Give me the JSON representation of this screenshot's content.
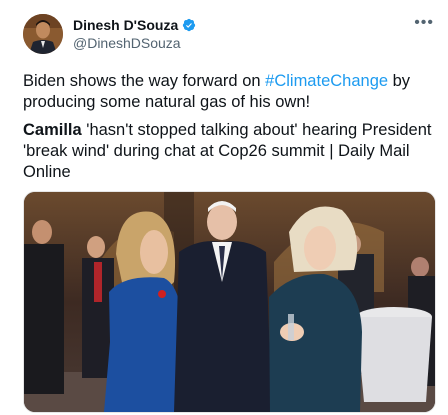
{
  "tweet": {
    "author_name": "Dinesh D'Souza",
    "author_handle": "@DineshDSouza",
    "verified": true,
    "more_icon": "ellipsis-icon",
    "text_before_hashtag": "Biden shows the way forward on ",
    "hashtag": "#ClimateChange",
    "text_after_hashtag": " by producing some natural gas of his own!",
    "headline_bold": "Camilla",
    "headline_rest": " 'hasn't stopped talking about' hearing President 'break wind' during chat at Cop26 summit | Daily Mail Online"
  },
  "colors": {
    "accent": "#1d9bf0",
    "secondary_text": "#536471"
  }
}
